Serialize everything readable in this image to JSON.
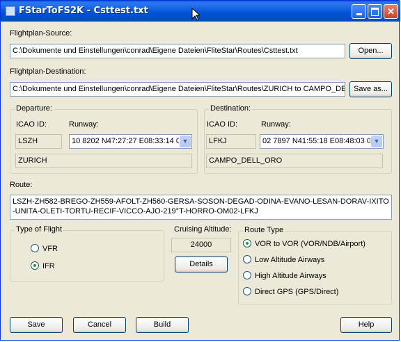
{
  "window": {
    "title": "FStarToFS2K - Csttest.txt"
  },
  "source": {
    "label": "Flightplan-Source:",
    "value": "C:\\Dokumente und Einstellungen\\conrad\\Eigene Dateien\\FliteStar\\Routes\\Csttest.txt",
    "button": "Open..."
  },
  "destination_file": {
    "label": "Flightplan-Destination:",
    "value": "C:\\Dokumente und Einstellungen\\conrad\\Eigene Dateien\\FliteStar\\Routes\\ZURICH to CAMPO_DE",
    "button": "Save as..."
  },
  "departure": {
    "group": "Departure:",
    "icao_label": "ICAO ID:",
    "runway_label": "Runway:",
    "icao": "LSZH",
    "runway": "10 8202 N47:27:27 E08:33:14 0",
    "name": "ZURICH"
  },
  "arrival": {
    "group": "Destination:",
    "icao_label": "ICAO ID:",
    "runway_label": "Runway:",
    "icao": "LFKJ",
    "runway": "02 7897 N41:55:18 E08:48:03 0",
    "name": "CAMPO_DELL_ORO"
  },
  "route": {
    "label": "Route:",
    "text": "LSZH-ZH582-BREGO-ZH559-AFOLT-ZH560-GERSA-SOSON-DEGAD-ODINA-EVANO-LESAN-DORAV-IXITO-UNITA-OLETI-TORTU-RECIF-VICCO-AJO-219°T-HORRO-OM02-LFKJ"
  },
  "flight_type": {
    "group": "Type of Flight",
    "options": [
      "VFR",
      "IFR"
    ],
    "selected": "IFR"
  },
  "cruise": {
    "label": "Cruising Altitude:",
    "value": "24000",
    "details_button": "Details"
  },
  "route_type": {
    "group": "Route Type",
    "options": [
      "VOR to VOR (VOR/NDB/Airport)",
      "Low Altitude Airways",
      "High Altitude Airways",
      "Direct GPS (GPS/Direct)"
    ],
    "selected": "VOR to VOR (VOR/NDB/Airport)"
  },
  "buttons": {
    "save": "Save",
    "cancel": "Cancel",
    "build": "Build",
    "help": "Help"
  },
  "colors": {
    "titlebar": "#0052d6",
    "dialog": "#ece9d8",
    "radio_dot": "#21a121"
  }
}
